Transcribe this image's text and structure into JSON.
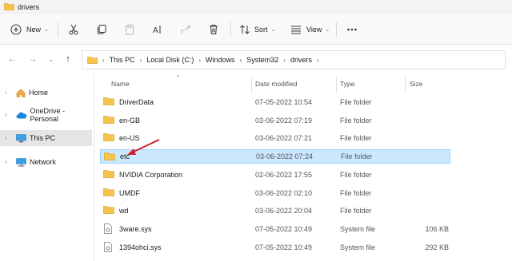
{
  "window": {
    "title": "drivers"
  },
  "toolbar": {
    "new_label": "New",
    "sort_label": "Sort",
    "view_label": "View"
  },
  "address": {
    "crumbs": [
      "This PC",
      "Local Disk (C:)",
      "Windows",
      "System32",
      "drivers"
    ]
  },
  "sidebar": {
    "items": [
      {
        "label": "Home"
      },
      {
        "label": "OneDrive - Personal"
      },
      {
        "label": "This PC"
      },
      {
        "label": "Network"
      }
    ]
  },
  "columns": {
    "name": "Name",
    "date": "Date modified",
    "type": "Type",
    "size": "Size"
  },
  "files": [
    {
      "name": "DriverData",
      "date": "07-05-2022 10:54",
      "type": "File folder",
      "size": ""
    },
    {
      "name": "en-GB",
      "date": "03-06-2022 07:19",
      "type": "File folder",
      "size": ""
    },
    {
      "name": "en-US",
      "date": "03-06-2022 07:21",
      "type": "File folder",
      "size": ""
    },
    {
      "name": "etc",
      "date": "03-06-2022 07:24",
      "type": "File folder",
      "size": ""
    },
    {
      "name": "NVIDIA Corporation",
      "date": "02-06-2022 17:55",
      "type": "File folder",
      "size": ""
    },
    {
      "name": "UMDF",
      "date": "03-06-2022 02:10",
      "type": "File folder",
      "size": ""
    },
    {
      "name": "wd",
      "date": "03-06-2022 20:04",
      "type": "File folder",
      "size": ""
    },
    {
      "name": "3ware.sys",
      "date": "07-05-2022 10:49",
      "type": "System file",
      "size": "106 KB"
    },
    {
      "name": "1394ohci.sys",
      "date": "07-05-2022 10:49",
      "type": "System file",
      "size": "292 KB"
    }
  ],
  "colors": {
    "selection": "#cce8ff",
    "selection_border": "#99d1ff",
    "folder": "#f4c54a",
    "arrow": "#d0202a"
  }
}
